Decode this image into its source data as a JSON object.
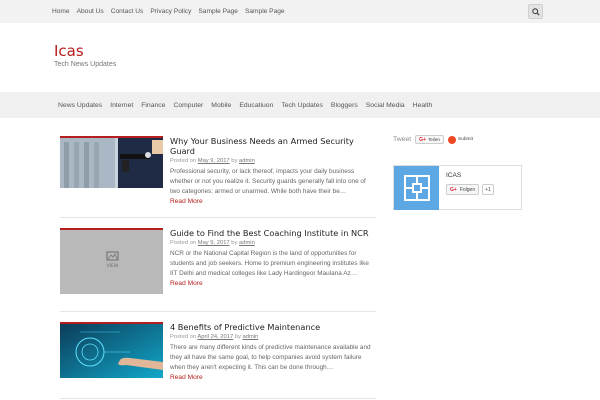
{
  "topnav": {
    "items": [
      "Home",
      "About Us",
      "Contact Us",
      "Privacy Policy",
      "Sample Page",
      "Sample Page"
    ]
  },
  "site": {
    "title": "Icas",
    "description": "Tech News Updates"
  },
  "mainnav": {
    "items": [
      "News Updates",
      "Internet",
      "Finance",
      "Computer",
      "Mobile",
      "Educatiuon",
      "Tech Updates",
      "Bloggers",
      "Social Media",
      "Health"
    ]
  },
  "posts": [
    {
      "title": "Why Your Business Needs an Armed Security Guard",
      "posted_on": "Posted on",
      "date": "May 9, 2017",
      "by": "by",
      "author": "admin",
      "excerpt": "Professional security, or lack thereof, impacts your daily business whether or not you realize it. Security guards generally fall into one of two categories: armed or unarmed. While both have their be…",
      "read_more": "Read More"
    },
    {
      "title": "Guide to Find the Best Coaching Institute in NCR",
      "posted_on": "Posted on",
      "date": "May 9, 2017",
      "by": "by",
      "author": "admin",
      "excerpt": "NCR or the National Capital Region is the land of opportunities for students and job seekers. Home to premium engineering institutes like IIT Delhi and medical colleges like Lady Hardingeor Maulana Az…",
      "read_more": "Read More",
      "placeholder_label": "VIEW"
    },
    {
      "title": "4 Benefits of Predictive Maintenance",
      "posted_on": "Posted on",
      "date": "April 24, 2017",
      "by": "by",
      "author": "admin",
      "excerpt": "There are many different kinds of predictive maintenance available and they all have the same goal, to help companies avoid system failure when they aren't expecting it. This can be done through…",
      "read_more": "Read More"
    }
  ],
  "sidebar": {
    "tweet": "Tweet",
    "gplus_share": "Teilen",
    "stumble": "Submit",
    "widget": {
      "name": "ICAS",
      "follow": "Folgen",
      "count": "+1"
    }
  },
  "colors": {
    "accent": "#b41e1e",
    "avatar_bg": "#5da8e4",
    "topbar_bg": "#f2f2f2"
  },
  "icons": [
    "search-icon",
    "google-plus-icon",
    "stumbleupon-icon",
    "image-placeholder-icon"
  ]
}
